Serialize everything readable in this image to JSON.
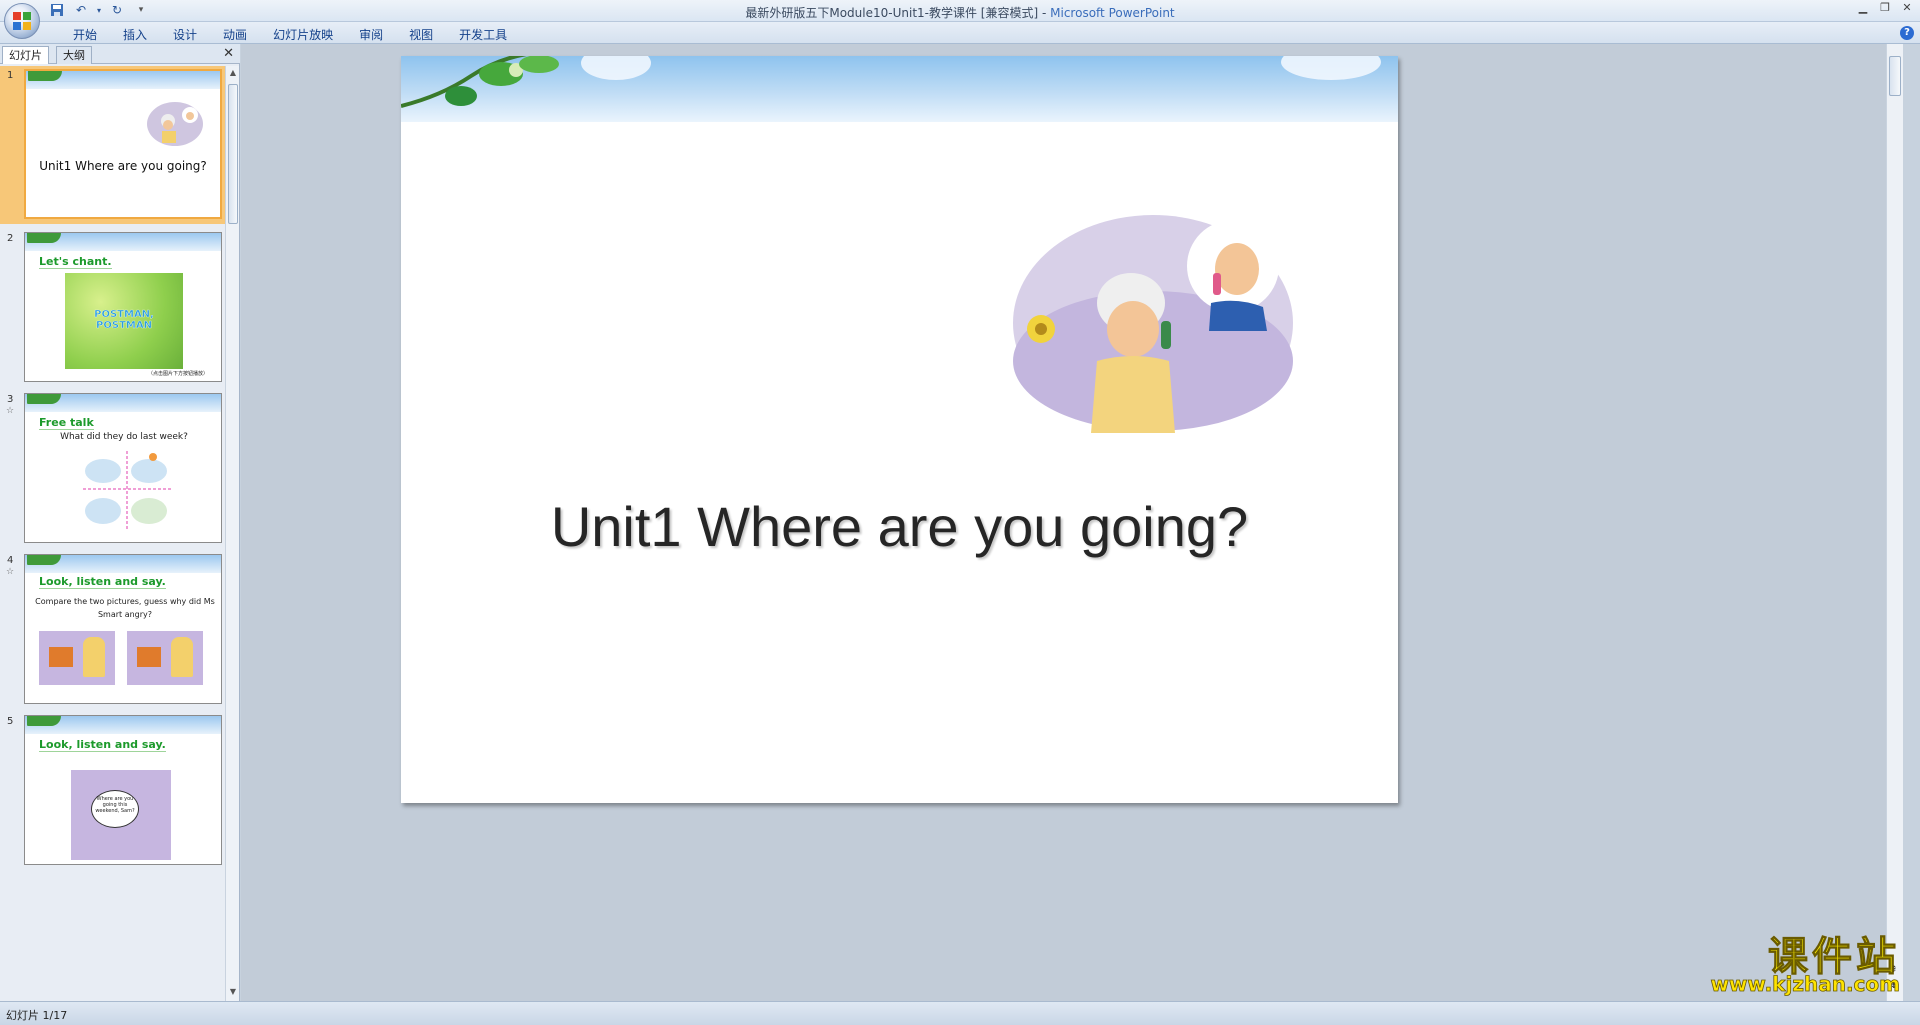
{
  "window": {
    "title": "最新外研版五下Module10-Unit1-教学课件 [兼容模式]",
    "separator": " - ",
    "app_name": "Microsoft PowerPoint"
  },
  "ribbon": {
    "tabs": [
      "开始",
      "插入",
      "设计",
      "动画",
      "幻灯片放映",
      "审阅",
      "视图",
      "开发工具"
    ]
  },
  "pane": {
    "tab_slides": "幻灯片",
    "tab_outline": "大纲"
  },
  "thumbnails": [
    {
      "num": "1",
      "title": "Unit1 Where are you going?"
    },
    {
      "num": "2",
      "heading": "Let's chant.",
      "banner": "POSTMAN, POSTMAN",
      "caption": "（点击图片下方按钮播放）"
    },
    {
      "num": "3",
      "heading": "Free talk",
      "text": "What did they do last week?"
    },
    {
      "num": "4",
      "heading": "Look, listen and say.",
      "text": "Compare the two pictures, guess why did  Ms Smart angry?"
    },
    {
      "num": "5",
      "heading": "Look, listen and say.",
      "bubble": "Where are you going this weekend, Sam?"
    }
  ],
  "slide": {
    "title": "Unit1 Where are you going?"
  },
  "status": {
    "slide_counter": "幻灯片 1/17"
  },
  "watermark": {
    "cn": "课件站",
    "url": "www.kjzhan.com"
  },
  "colors": {
    "accent_green": "#1c9a2b",
    "selection_orange": "#f7c778",
    "title_blue": "#3a6dbb"
  }
}
